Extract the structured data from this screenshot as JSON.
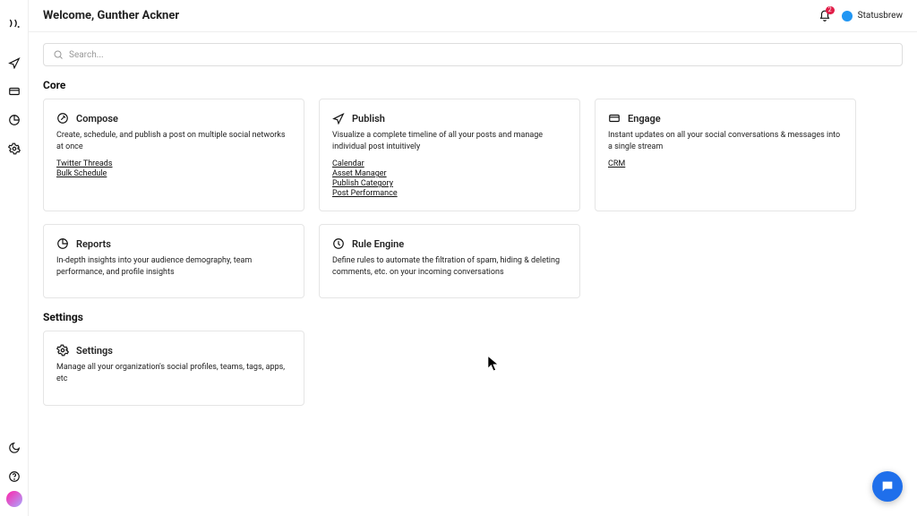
{
  "header": {
    "title": "Welcome, Gunther Ackner",
    "notifications_count": "2",
    "workspace_name": "Statusbrew"
  },
  "search": {
    "placeholder": "Search..."
  },
  "sections": {
    "core": {
      "title": "Core"
    },
    "settings": {
      "title": "Settings"
    }
  },
  "cards": {
    "compose": {
      "title": "Compose",
      "desc": "Create, schedule, and publish a post on multiple social networks at once",
      "links": [
        "Twitter Threads",
        "Bulk Schedule"
      ]
    },
    "publish": {
      "title": "Publish",
      "desc": "Visualize a complete timeline of all your posts and manage individual post intuitively",
      "links": [
        "Calendar",
        "Asset Manager",
        "Publish Category",
        "Post Performance"
      ]
    },
    "engage": {
      "title": "Engage",
      "desc": "Instant updates on all your social conversations & messages into a single stream",
      "links": [
        "CRM"
      ]
    },
    "reports": {
      "title": "Reports",
      "desc": "In-depth insights into your audience demography, team performance, and profile insights"
    },
    "rule_engine": {
      "title": "Rule Engine",
      "desc": "Define rules to automate the filtration of spam, hiding & deleting comments, etc. on your incoming conversations"
    },
    "settings_card": {
      "title": "Settings",
      "desc": "Manage all your organization's social profiles, teams, tags, apps, etc"
    }
  }
}
